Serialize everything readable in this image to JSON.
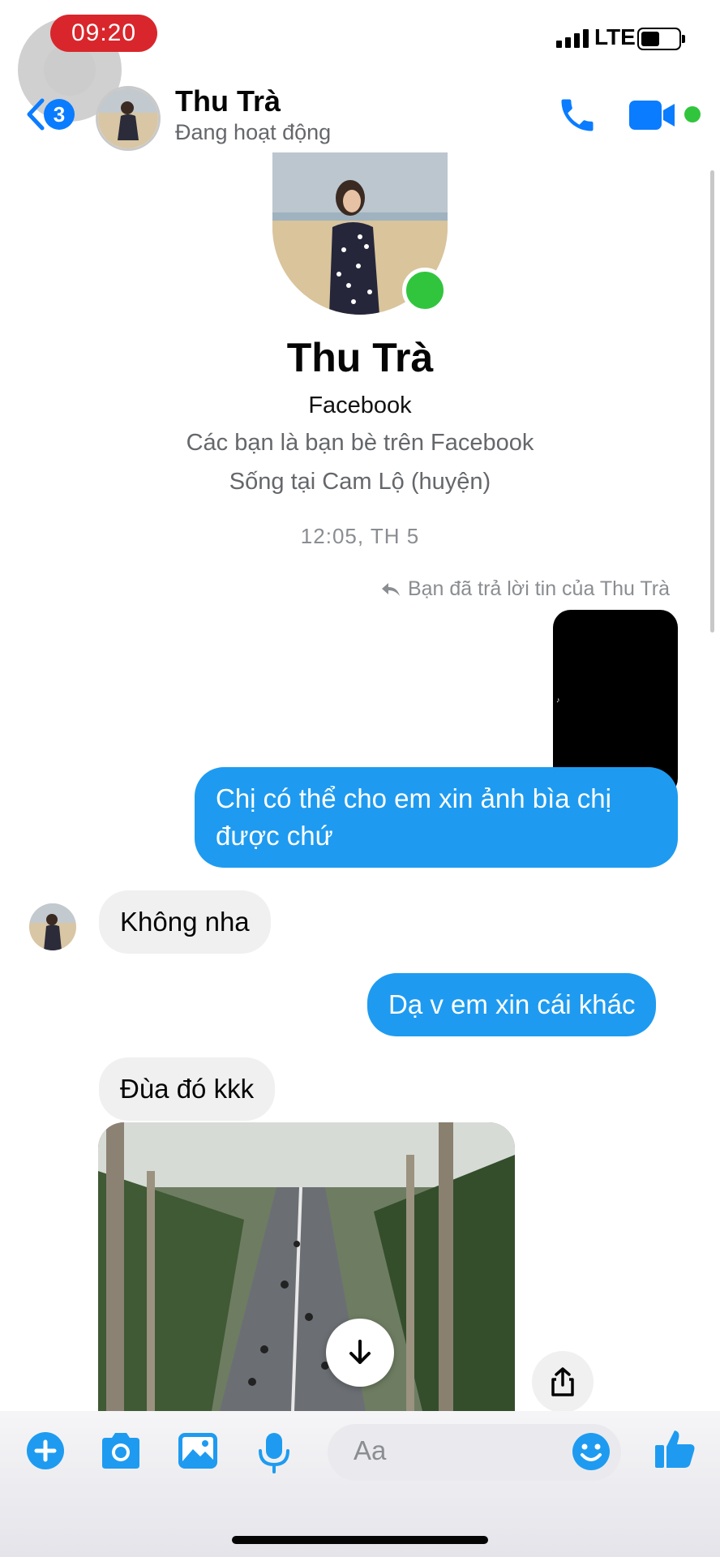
{
  "status_bar": {
    "time": "09:20",
    "network": "LTE",
    "battery_level": 0.5
  },
  "header": {
    "back_badge": "3",
    "contact_name": "Thu Trà",
    "contact_status": "Đang hoạt động"
  },
  "profile": {
    "name": "Thu Trà",
    "source": "Facebook",
    "friends_note": "Các bạn là bạn bè trên Facebook",
    "lives_in": "Sống tại Cam Lộ (huyện)",
    "online": true
  },
  "thread": {
    "timestamp": "12:05, TH 5",
    "reply_note": "Bạn đã trả lời tin của Thu Trà",
    "messages": [
      {
        "direction": "out",
        "text": "Chị có thể cho em xin ảnh bìa chị được chứ"
      },
      {
        "direction": "in",
        "text": "Không nha"
      },
      {
        "direction": "out",
        "text": "Dạ v em xin cái khác"
      },
      {
        "direction": "in",
        "text": "Đùa đó kkk"
      }
    ]
  },
  "composer": {
    "placeholder": "Aa"
  },
  "colors": {
    "accent": "#0a7cff",
    "bubble_out": "#1e9bf0",
    "bubble_in": "#f0f0f0",
    "online": "#31c53e",
    "time_pill": "#d9262c"
  },
  "icons": {
    "header": [
      "back-chevron-icon",
      "phone-icon",
      "video-camera-icon"
    ],
    "composer": [
      "plus-icon",
      "camera-icon",
      "gallery-icon",
      "microphone-icon",
      "emoji-icon",
      "thumbs-up-icon"
    ],
    "media": [
      "download-icon",
      "share-icon"
    ]
  }
}
